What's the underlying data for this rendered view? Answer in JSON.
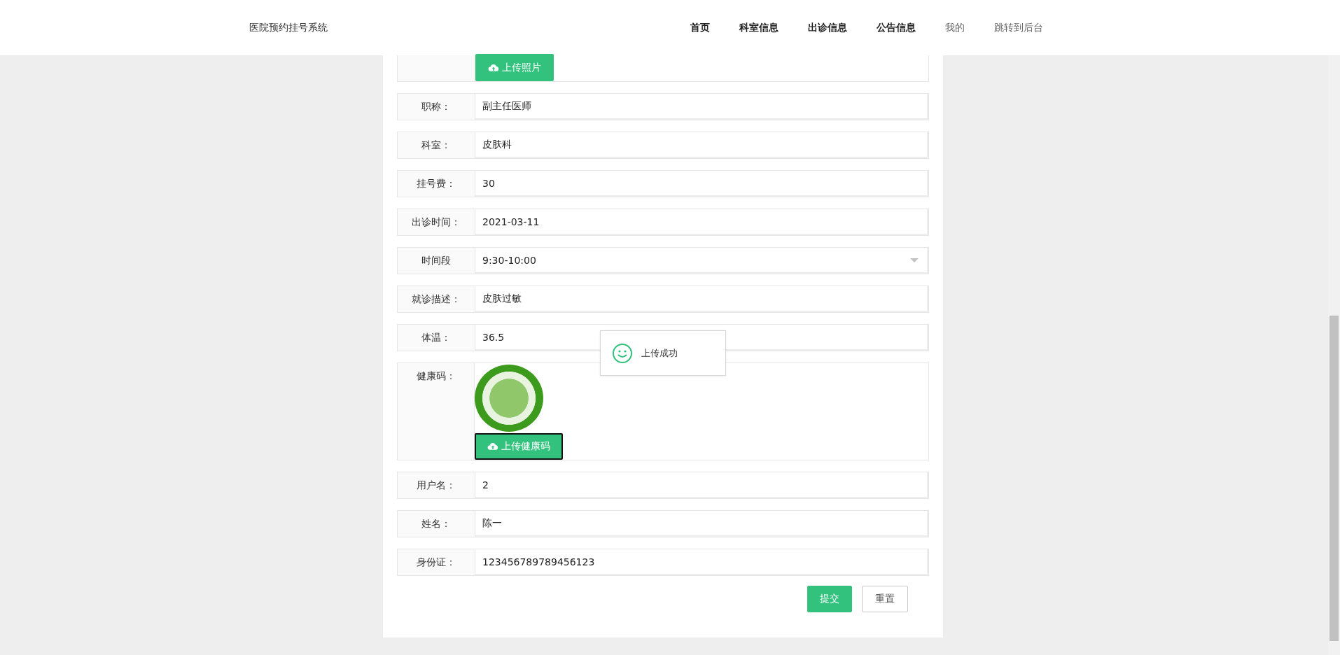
{
  "header": {
    "title": "医院预约挂号系统",
    "nav": [
      {
        "label": "首页",
        "muted": false
      },
      {
        "label": "科室信息",
        "muted": false
      },
      {
        "label": "出诊信息",
        "muted": false
      },
      {
        "label": "公告信息",
        "muted": false
      },
      {
        "label": "我的",
        "muted": true
      },
      {
        "label": "跳转到后台",
        "muted": true
      }
    ]
  },
  "form": {
    "rows": [
      {
        "kind": "upload",
        "button": "上传照片",
        "focused": false
      },
      {
        "kind": "text",
        "label": "职称：",
        "value": "副主任医师"
      },
      {
        "kind": "text",
        "label": "科室：",
        "value": "皮肤科"
      },
      {
        "kind": "text",
        "label": "挂号费：",
        "value": "30"
      },
      {
        "kind": "text",
        "label": "出诊时间：",
        "value": "2021-03-11"
      },
      {
        "kind": "select",
        "label": "时间段",
        "value": "9:30-10:00"
      },
      {
        "kind": "text",
        "label": "就诊描述：",
        "value": "皮肤过敏"
      },
      {
        "kind": "text",
        "label": "体温：",
        "value": "36.5"
      },
      {
        "kind": "image-upload",
        "label": "健康码：",
        "button": "上传健康码",
        "focused": true
      },
      {
        "kind": "text",
        "label": "用户名：",
        "value": "2"
      },
      {
        "kind": "text",
        "label": "姓名：",
        "value": "陈一"
      },
      {
        "kind": "text",
        "label": "身份证：",
        "value": "123456789789456123"
      }
    ],
    "buttons": [
      {
        "label": "提交",
        "primary": true
      },
      {
        "label": "重置",
        "primary": false
      }
    ]
  },
  "toast": {
    "message": "上传成功"
  }
}
